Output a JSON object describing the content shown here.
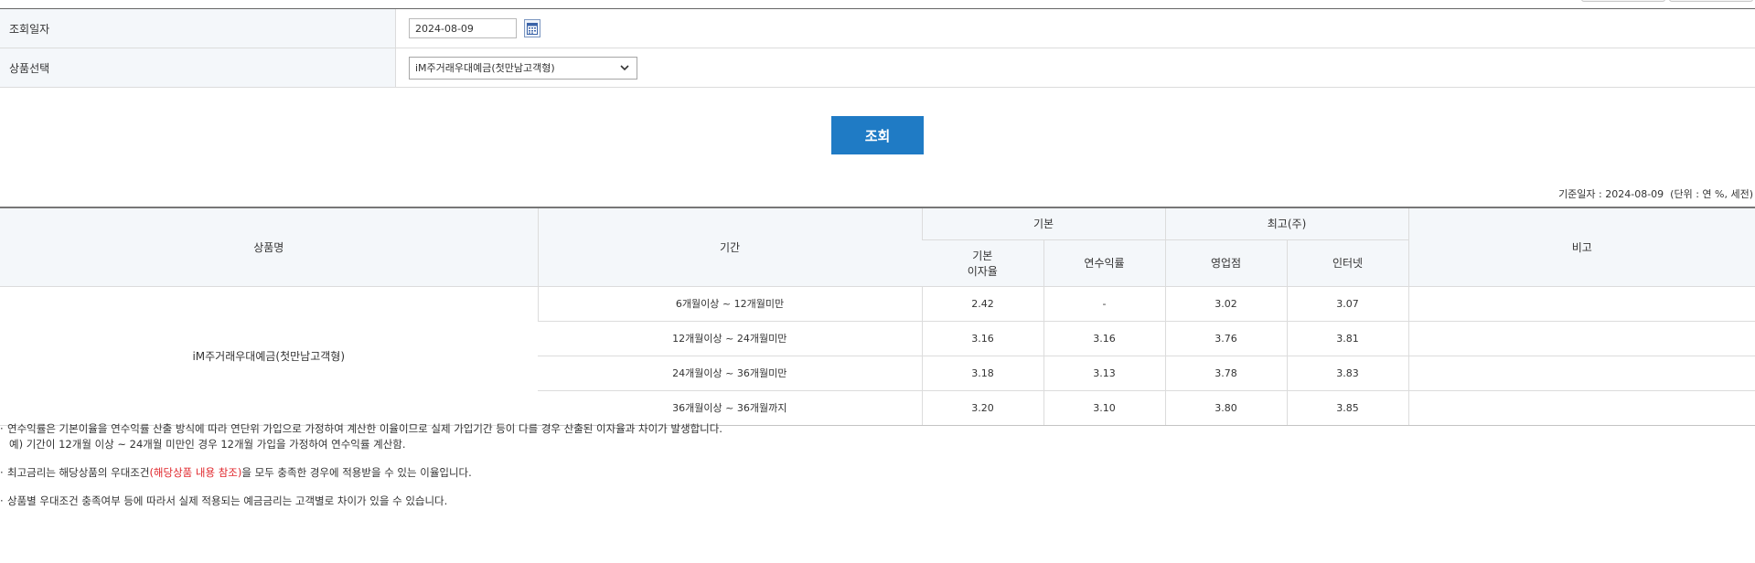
{
  "filters": {
    "date_label": "조회일자",
    "date_value": "2024-08-09",
    "product_label": "상품선택",
    "product_value": "iM주거래우대예금(첫만남고객형)"
  },
  "inquiry_button": "조회",
  "base_date_text": "기준일자 : 2024-08-09  (단위 : 연 %, 세전)",
  "table": {
    "headers": {
      "product_name": "상품명",
      "period": "기간",
      "basic": "기본",
      "max": "최고(주)",
      "remarks": "비고",
      "basic_rate_line1": "기본",
      "basic_rate_line2": "이자율",
      "annual_yield": "연수익률",
      "branch": "영업점",
      "internet": "인터넷"
    },
    "product_name": "iM주거래우대예금(첫만남고객형)",
    "rows": [
      {
        "period": "6개월이상 ~ 12개월미만",
        "basic_rate": "2.42",
        "annual_yield": "-",
        "branch": "3.02",
        "internet": "3.07",
        "remarks": ""
      },
      {
        "period": "12개월이상 ~ 24개월미만",
        "basic_rate": "3.16",
        "annual_yield": "3.16",
        "branch": "3.76",
        "internet": "3.81",
        "remarks": ""
      },
      {
        "period": "24개월이상 ~ 36개월미만",
        "basic_rate": "3.18",
        "annual_yield": "3.13",
        "branch": "3.78",
        "internet": "3.83",
        "remarks": ""
      },
      {
        "period": "36개월이상 ~ 36개월까지",
        "basic_rate": "3.20",
        "annual_yield": "3.10",
        "branch": "3.80",
        "internet": "3.85",
        "remarks": ""
      }
    ]
  },
  "notes": {
    "note1": "연수익률은 기본이율을 연수익률 산출 방식에 따라 연단위 가입으로 가정하여 계산한 이율이므로 실제 가입기간 등이 다를 경우 산출된 이자율과 차이가 발생합니다.",
    "note1_example": "예) 기간이 12개월 이상 ~ 24개월 미만인 경우 12개월 가입을 가정하여 연수익률 계산함.",
    "note2_before": "최고금리는 해당상품의 우대조건",
    "note2_link": "(해당상품 내용 참조)",
    "note2_after": "을 모두 충족한 경우에 적용받을 수 있는 이율입니다.",
    "note3": "상품별 우대조건 충족여부 등에 따라서 실제 적용되는 예금금리는 고객별로 차이가 있을 수 있습니다."
  },
  "colors": {
    "accent_button": "#1f7bc5",
    "header_bg": "#f4f7fa",
    "link_red": "#e0262b"
  }
}
